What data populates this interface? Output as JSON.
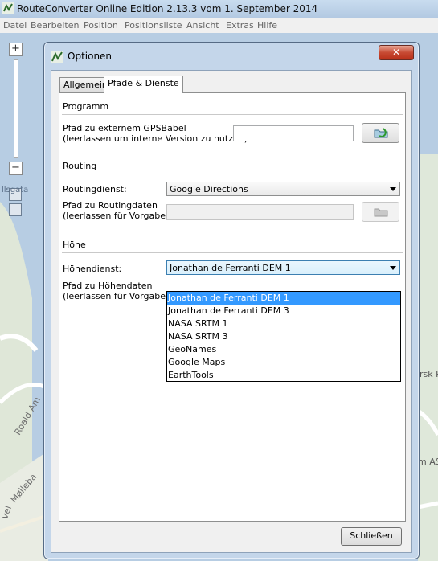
{
  "app": {
    "title": "RouteConverter Online Edition 2.13.3 vom 1. September 2014",
    "menu": [
      "Datei",
      "Bearbeiten",
      "Position",
      "Positionsliste",
      "Ansicht",
      "Extras",
      "Hilfe"
    ]
  },
  "map": {
    "zoom_in": "+",
    "zoom_out": "−",
    "labels": [
      "Roald Am",
      "Mølleba",
      "rsk R",
      "m AS",
      "llsgata",
      "vel"
    ]
  },
  "dialog": {
    "title": "Optionen",
    "close_glyph": "✕",
    "tabs": [
      {
        "label": "Allgemein",
        "active": false
      },
      {
        "label": "Pfade & Dienste",
        "active": true
      }
    ],
    "programm": {
      "heading": "Programm",
      "gpsbabel_label_line1": "Pfad zu externem GPSBabel",
      "gpsbabel_label_line2": "(leerlassen um interne Version zu nutzen):",
      "gpsbabel_value": ""
    },
    "routing": {
      "heading": "Routing",
      "service_label": "Routingdienst:",
      "service_value": "Google Directions",
      "path_label_line1": "Pfad zu Routingdaten",
      "path_label_line2": "(leerlassen für Vorgabe):",
      "path_value": ""
    },
    "elevation": {
      "heading": "Höhe",
      "service_label": "Höhendienst:",
      "service_value": "Jonathan de Ferranti DEM 1",
      "path_label_line1": "Pfad zu Höhendaten",
      "path_label_line2": "(leerlassen für Vorgabe):",
      "options": [
        "Jonathan de Ferranti DEM 1",
        "Jonathan de Ferranti DEM 3",
        "NASA SRTM 1",
        "NASA SRTM 3",
        "GeoNames",
        "Google Maps",
        "EarthTools"
      ],
      "selected_index": 0
    },
    "close_button": "Schließen"
  },
  "colors": {
    "accent_selection": "#3399ff",
    "title_bar": "#c4d6ea",
    "close_red": "#c74a33"
  }
}
